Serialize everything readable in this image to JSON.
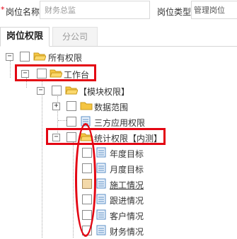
{
  "form": {
    "required_mark": "*",
    "position_name_label": "岗位名称",
    "position_name_value": "财务总监",
    "position_type_label": "岗位类型",
    "position_type_value": "管理岗位"
  },
  "tabs": [
    {
      "label": "岗位权限"
    },
    {
      "label": "分公司"
    }
  ],
  "tree": {
    "root": {
      "label": "所有权限",
      "toggle": "−"
    },
    "workbench": {
      "label": "工作台",
      "toggle": "−"
    },
    "module": {
      "label": "【模块权限】",
      "toggle": "−"
    },
    "data_scope": {
      "label": "数据范围",
      "toggle": "+"
    },
    "third_party": {
      "label": "三方应用权限"
    },
    "stats": {
      "label": "统计权限【内测】",
      "toggle": "−"
    },
    "stats_items": [
      {
        "label": "年度目标"
      },
      {
        "label": "月度目标"
      },
      {
        "label": "施工情况"
      },
      {
        "label": "跟进情况"
      },
      {
        "label": "客户情况"
      },
      {
        "label": "财务情况"
      }
    ]
  },
  "colors": {
    "highlight": "#e30613",
    "folder": "#f5c542",
    "page_icon": "#5b8fc7"
  }
}
